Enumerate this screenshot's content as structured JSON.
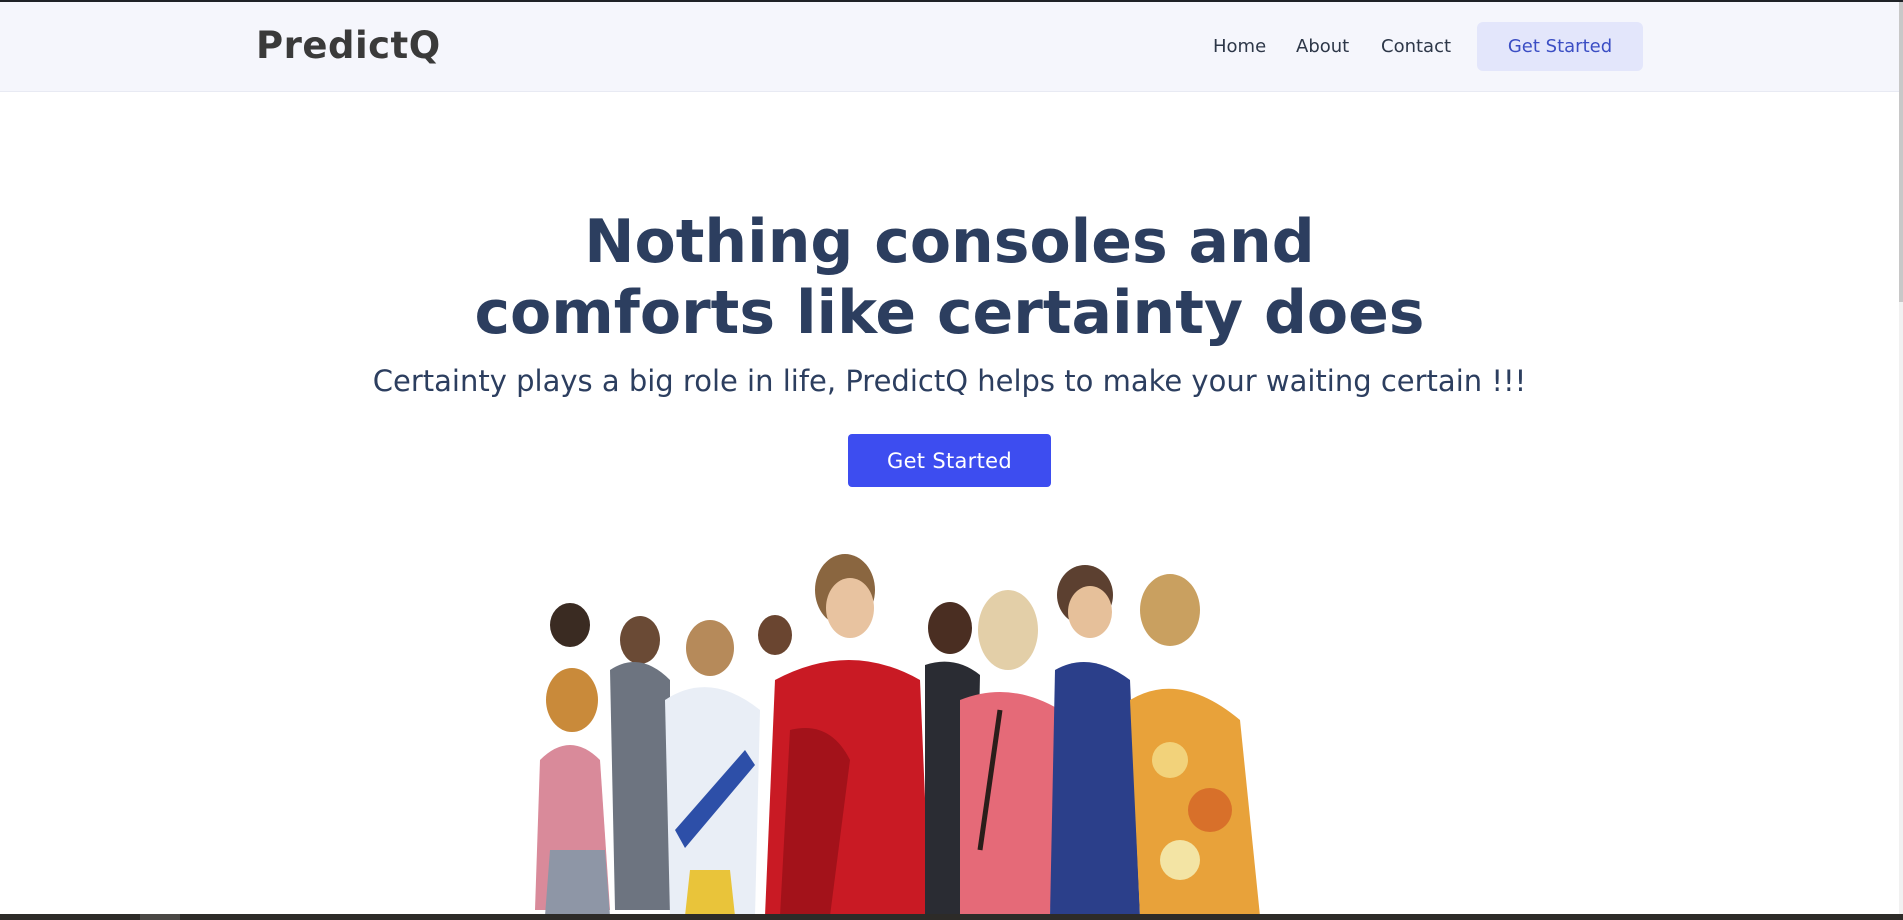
{
  "navbar": {
    "brand": "PredictQ",
    "links": [
      {
        "label": "Home"
      },
      {
        "label": "About"
      },
      {
        "label": "Contact"
      }
    ],
    "cta_label": "Get Started"
  },
  "hero": {
    "title_line1": "Nothing consoles and",
    "title_line2": "comforts like certainty does",
    "subtitle": "Certainty plays a big role in life, PredictQ helps to make your waiting certain !!!",
    "cta_label": "Get Started",
    "image": "crowd-illustration"
  },
  "colors": {
    "accent": "#3d4df0",
    "heading": "#2c3e5f",
    "nav_bg": "#f5f6fc",
    "nav_cta_bg": "#e3e6fb"
  }
}
